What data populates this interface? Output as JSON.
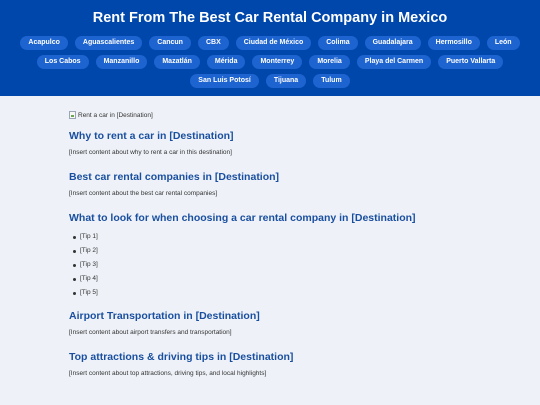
{
  "hero": {
    "title": "Rent From The Best Car Rental Company in Mexico",
    "destinations": [
      "Acapulco",
      "Aguascalientes",
      "Cancun",
      "CBX",
      "Ciudad de México",
      "Colima",
      "Guadalajara",
      "Hermosillo",
      "León",
      "Los Cabos",
      "Manzanillo",
      "Mazatlán",
      "Mérida",
      "Monterrey",
      "Morelia",
      "Playa del Carmen",
      "Puerto Vallarta",
      "San Luis Potosí",
      "Tijuana",
      "Tulum"
    ]
  },
  "main": {
    "image_alt": "Rent a car in [Destination]",
    "sections": [
      {
        "heading": "Why to rent a car in [Destination]",
        "text": "[Insert content about why to rent a car in this destination]"
      },
      {
        "heading": "Best car rental companies in [Destination]",
        "text": "[Insert content about the best car rental companies]"
      },
      {
        "heading": "What to look for when choosing a car rental company in [Destination]",
        "tips": [
          "[Tip 1]",
          "[Tip 2]",
          "[Tip 3]",
          "[Tip 4]",
          "[Tip 5]"
        ]
      },
      {
        "heading": "Airport Transportation in [Destination]",
        "text": "[Insert content about airport transfers and transportation]"
      },
      {
        "heading": "Top attractions & driving tips in [Destination]",
        "text": "[Insert content about top attractions, driving tips, and local highlights]"
      }
    ]
  },
  "colors": {
    "hero_background": "#0047ab",
    "pill_background": "#1e64d0",
    "heading_blue": "#1a4fa0",
    "page_background": "#eef2f8"
  }
}
